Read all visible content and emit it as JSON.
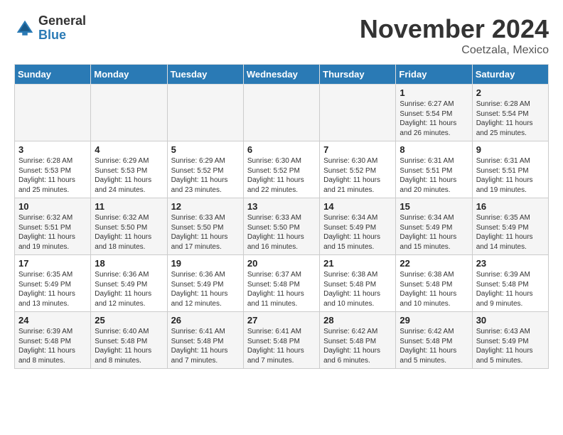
{
  "header": {
    "logo_general": "General",
    "logo_blue": "Blue",
    "month_title": "November 2024",
    "location": "Coetzala, Mexico"
  },
  "days_of_week": [
    "Sunday",
    "Monday",
    "Tuesday",
    "Wednesday",
    "Thursday",
    "Friday",
    "Saturday"
  ],
  "weeks": [
    [
      {
        "day": "",
        "info": ""
      },
      {
        "day": "",
        "info": ""
      },
      {
        "day": "",
        "info": ""
      },
      {
        "day": "",
        "info": ""
      },
      {
        "day": "",
        "info": ""
      },
      {
        "day": "1",
        "info": "Sunrise: 6:27 AM\nSunset: 5:54 PM\nDaylight: 11 hours and 26 minutes."
      },
      {
        "day": "2",
        "info": "Sunrise: 6:28 AM\nSunset: 5:54 PM\nDaylight: 11 hours and 25 minutes."
      }
    ],
    [
      {
        "day": "3",
        "info": "Sunrise: 6:28 AM\nSunset: 5:53 PM\nDaylight: 11 hours and 25 minutes."
      },
      {
        "day": "4",
        "info": "Sunrise: 6:29 AM\nSunset: 5:53 PM\nDaylight: 11 hours and 24 minutes."
      },
      {
        "day": "5",
        "info": "Sunrise: 6:29 AM\nSunset: 5:52 PM\nDaylight: 11 hours and 23 minutes."
      },
      {
        "day": "6",
        "info": "Sunrise: 6:30 AM\nSunset: 5:52 PM\nDaylight: 11 hours and 22 minutes."
      },
      {
        "day": "7",
        "info": "Sunrise: 6:30 AM\nSunset: 5:52 PM\nDaylight: 11 hours and 21 minutes."
      },
      {
        "day": "8",
        "info": "Sunrise: 6:31 AM\nSunset: 5:51 PM\nDaylight: 11 hours and 20 minutes."
      },
      {
        "day": "9",
        "info": "Sunrise: 6:31 AM\nSunset: 5:51 PM\nDaylight: 11 hours and 19 minutes."
      }
    ],
    [
      {
        "day": "10",
        "info": "Sunrise: 6:32 AM\nSunset: 5:51 PM\nDaylight: 11 hours and 19 minutes."
      },
      {
        "day": "11",
        "info": "Sunrise: 6:32 AM\nSunset: 5:50 PM\nDaylight: 11 hours and 18 minutes."
      },
      {
        "day": "12",
        "info": "Sunrise: 6:33 AM\nSunset: 5:50 PM\nDaylight: 11 hours and 17 minutes."
      },
      {
        "day": "13",
        "info": "Sunrise: 6:33 AM\nSunset: 5:50 PM\nDaylight: 11 hours and 16 minutes."
      },
      {
        "day": "14",
        "info": "Sunrise: 6:34 AM\nSunset: 5:49 PM\nDaylight: 11 hours and 15 minutes."
      },
      {
        "day": "15",
        "info": "Sunrise: 6:34 AM\nSunset: 5:49 PM\nDaylight: 11 hours and 15 minutes."
      },
      {
        "day": "16",
        "info": "Sunrise: 6:35 AM\nSunset: 5:49 PM\nDaylight: 11 hours and 14 minutes."
      }
    ],
    [
      {
        "day": "17",
        "info": "Sunrise: 6:35 AM\nSunset: 5:49 PM\nDaylight: 11 hours and 13 minutes."
      },
      {
        "day": "18",
        "info": "Sunrise: 6:36 AM\nSunset: 5:49 PM\nDaylight: 11 hours and 12 minutes."
      },
      {
        "day": "19",
        "info": "Sunrise: 6:36 AM\nSunset: 5:49 PM\nDaylight: 11 hours and 12 minutes."
      },
      {
        "day": "20",
        "info": "Sunrise: 6:37 AM\nSunset: 5:48 PM\nDaylight: 11 hours and 11 minutes."
      },
      {
        "day": "21",
        "info": "Sunrise: 6:38 AM\nSunset: 5:48 PM\nDaylight: 11 hours and 10 minutes."
      },
      {
        "day": "22",
        "info": "Sunrise: 6:38 AM\nSunset: 5:48 PM\nDaylight: 11 hours and 10 minutes."
      },
      {
        "day": "23",
        "info": "Sunrise: 6:39 AM\nSunset: 5:48 PM\nDaylight: 11 hours and 9 minutes."
      }
    ],
    [
      {
        "day": "24",
        "info": "Sunrise: 6:39 AM\nSunset: 5:48 PM\nDaylight: 11 hours and 8 minutes."
      },
      {
        "day": "25",
        "info": "Sunrise: 6:40 AM\nSunset: 5:48 PM\nDaylight: 11 hours and 8 minutes."
      },
      {
        "day": "26",
        "info": "Sunrise: 6:41 AM\nSunset: 5:48 PM\nDaylight: 11 hours and 7 minutes."
      },
      {
        "day": "27",
        "info": "Sunrise: 6:41 AM\nSunset: 5:48 PM\nDaylight: 11 hours and 7 minutes."
      },
      {
        "day": "28",
        "info": "Sunrise: 6:42 AM\nSunset: 5:48 PM\nDaylight: 11 hours and 6 minutes."
      },
      {
        "day": "29",
        "info": "Sunrise: 6:42 AM\nSunset: 5:48 PM\nDaylight: 11 hours and 5 minutes."
      },
      {
        "day": "30",
        "info": "Sunrise: 6:43 AM\nSunset: 5:49 PM\nDaylight: 11 hours and 5 minutes."
      }
    ]
  ]
}
